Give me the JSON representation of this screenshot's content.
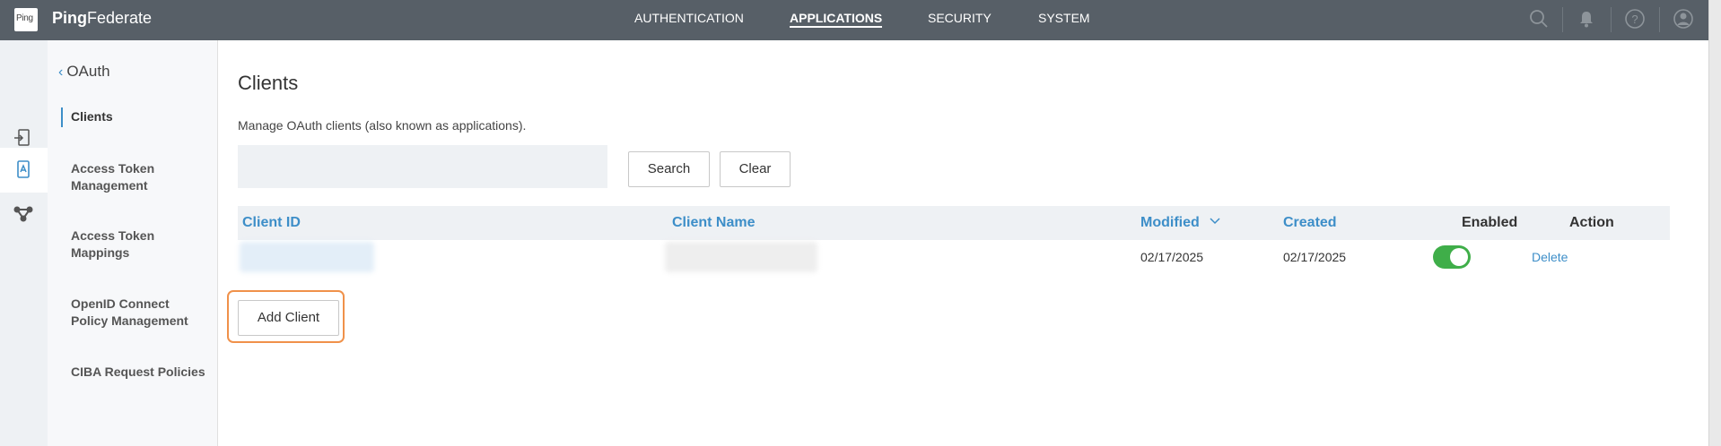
{
  "app": {
    "logo_text": "Ping",
    "brand_bold": "Ping",
    "brand_rest": "Federate"
  },
  "topnav": {
    "items": [
      "AUTHENTICATION",
      "APPLICATIONS",
      "SECURITY",
      "SYSTEM"
    ],
    "active": "APPLICATIONS",
    "icons": [
      "search-icon",
      "bell-icon",
      "help-icon",
      "user-icon"
    ]
  },
  "icon_rail": {
    "items": [
      "authentication-icon",
      "applications-icon",
      "security-icon"
    ],
    "active": "applications-icon"
  },
  "sidenav": {
    "back_label": "OAuth",
    "items": [
      "Clients",
      "Access Token Management",
      "Access Token Mappings",
      "OpenID Connect Policy Management",
      "CIBA Request Policies"
    ],
    "active": "Clients"
  },
  "page": {
    "title": "Clients",
    "description": "Manage OAuth clients (also known as applications).",
    "search_value": "",
    "search_button": "Search",
    "clear_button": "Clear",
    "add_button": "Add Client"
  },
  "table": {
    "headers": {
      "client_id": "Client ID",
      "client_name": "Client Name",
      "modified": "Modified",
      "created": "Created",
      "enabled": "Enabled",
      "action": "Action"
    },
    "sort": {
      "column": "Modified",
      "direction": "descending"
    },
    "rows": [
      {
        "client_id": "",
        "client_name": "",
        "modified": "02/17/2025",
        "created": "02/17/2025",
        "enabled": true,
        "action": "Delete"
      }
    ]
  },
  "colors": {
    "topbar": "#575f67",
    "link": "#3d8ec8",
    "toggle_on": "#3fae49",
    "highlight": "#f0914a"
  }
}
